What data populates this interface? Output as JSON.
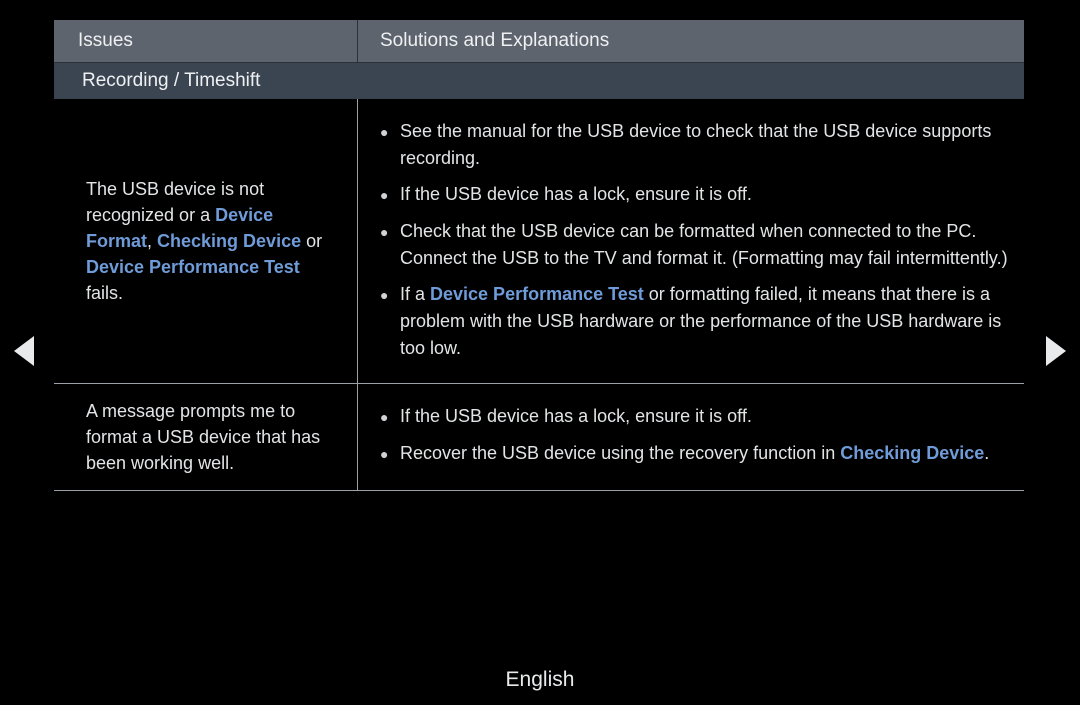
{
  "table": {
    "header": {
      "issues": "Issues",
      "solutions": "Solutions and Explanations"
    },
    "section": "Recording / Timeshift",
    "rows": [
      {
        "issue_parts": [
          {
            "t": "The USB device is not recognized or a ",
            "hl": false
          },
          {
            "t": "Device Format",
            "hl": true
          },
          {
            "t": ", ",
            "hl": false
          },
          {
            "t": "Checking Device",
            "hl": true
          },
          {
            "t": " or ",
            "hl": false
          },
          {
            "t": "Device Performance Test",
            "hl": true
          },
          {
            "t": " fails.",
            "hl": false
          }
        ],
        "bullets": [
          [
            {
              "t": "See the manual for the USB device to check that the USB device supports recording.",
              "hl": false
            }
          ],
          [
            {
              "t": "If the USB device has a lock, ensure it is off.",
              "hl": false
            }
          ],
          [
            {
              "t": "Check that the USB device can be formatted when connected to the PC. Connect the USB to the TV and format it. (Formatting may fail intermittently.)",
              "hl": false
            }
          ],
          [
            {
              "t": "If a ",
              "hl": false
            },
            {
              "t": "Device Performance Test",
              "hl": true
            },
            {
              "t": " or formatting failed, it means that there is a problem with the USB hardware or the performance of the USB hardware is too low.",
              "hl": false
            }
          ]
        ]
      },
      {
        "issue_parts": [
          {
            "t": "A message prompts me to format a USB device that has been working well.",
            "hl": false
          }
        ],
        "bullets": [
          [
            {
              "t": "If the USB device has a lock, ensure it is off.",
              "hl": false
            }
          ],
          [
            {
              "t": "Recover the USB device using the recovery function in ",
              "hl": false
            },
            {
              "t": "Checking Device",
              "hl": true
            },
            {
              "t": ".",
              "hl": false
            }
          ]
        ]
      }
    ]
  },
  "nav": {
    "prev_icon": "triangle-left-icon",
    "next_icon": "triangle-right-icon"
  },
  "footer": {
    "language": "English"
  },
  "colors": {
    "highlight": "#6f9bd8",
    "header_bg": "#5d646e",
    "section_bg": "#3b4552"
  },
  "bullet_glyph": "●"
}
